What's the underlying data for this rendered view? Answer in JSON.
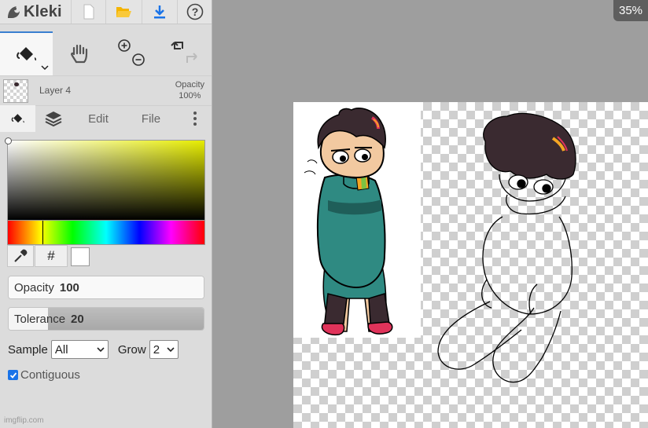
{
  "app": {
    "name": "Kleki",
    "zoom": "35%"
  },
  "toolbar": {
    "new_icon": "new-file-icon",
    "open_icon": "open-folder-icon",
    "save_icon": "download-icon",
    "help_icon": "help-icon"
  },
  "layer": {
    "name": "Layer 4",
    "opacity_label": "Opacity",
    "opacity_value": "100%"
  },
  "tabs": {
    "edit": "Edit",
    "file": "File"
  },
  "color": {
    "selected": "#ffffff",
    "hex_button": "#"
  },
  "sliders": {
    "opacity": {
      "label": "Opacity",
      "value": "100",
      "fraction": 1.0
    },
    "tolerance": {
      "label": "Tolerance",
      "value": "20",
      "fraction": 0.2
    }
  },
  "options": {
    "sample_label": "Sample",
    "sample_value": "All",
    "grow_label": "Grow",
    "grow_value": "2",
    "contiguous_label": "Contiguous",
    "contiguous_checked": true
  },
  "watermark": "imgflip.com",
  "colors": {
    "accent": "#3a7fd0",
    "checkbox": "#1a73e8",
    "sweater": "#2f8a82",
    "hair": "#3a2a30",
    "shoes": "#e0335a"
  }
}
